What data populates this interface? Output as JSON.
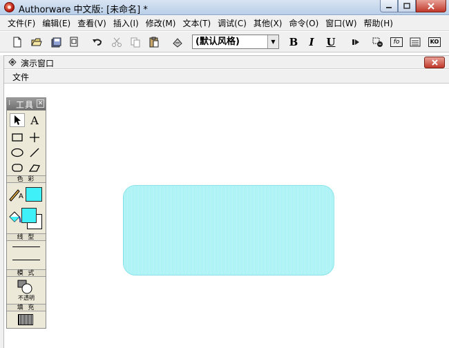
{
  "window": {
    "title": "Authorware 中文版: [未命名] *"
  },
  "menu": [
    "文件(F)",
    "编辑(E)",
    "查看(V)",
    "插入(I)",
    "修改(M)",
    "文本(T)",
    "调试(C)",
    "其他(X)",
    "命令(O)",
    "窗口(W)",
    "帮助(H)"
  ],
  "toolbar": {
    "style_value": "(默认风格)",
    "bold": "B",
    "italic": "I",
    "underline": "U",
    "fn_label": "fo",
    "ko_label": "KO"
  },
  "presentation": {
    "title": "演示窗口",
    "menu_file": "文件"
  },
  "tools": {
    "title": "工具",
    "text_tool": "A",
    "color_label": "色 彩",
    "line_color_letter": "A",
    "line_label": "线 型",
    "mode_label": "模 式",
    "mode_value": "不透明",
    "fill_label": "填 充",
    "fill_color": "#3ff0f8"
  },
  "shape": {
    "fill": "#a8f1f5"
  },
  "colors": {
    "accent_close": "#c0392b"
  }
}
